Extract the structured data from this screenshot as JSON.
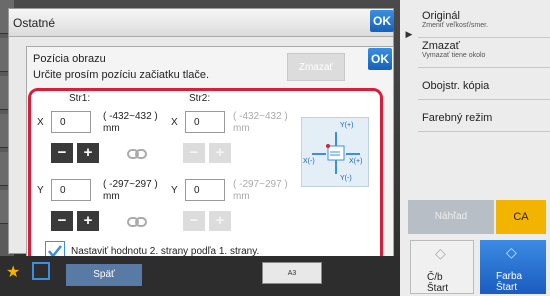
{
  "outer_dialog": {
    "title": "Ostatné",
    "ok_label": "OK"
  },
  "inner_dialog": {
    "title": "Pozícia obrazu",
    "subtitle": "Určite prosím pozíciu začiatku tlače.",
    "clear_label": "Zmazať",
    "ok_label": "OK"
  },
  "side1": {
    "header": "Str1:",
    "x_axis": "X",
    "x_value": "0",
    "x_range": "( -432~432 )",
    "x_unit": "mm",
    "y_axis": "Y",
    "y_value": "0",
    "y_range": "( -297~297 )",
    "y_unit": "mm",
    "minus": "−",
    "plus": "+"
  },
  "side2": {
    "header": "Str2:",
    "x_axis": "X",
    "x_value": "0",
    "x_range": "( -432~432 )",
    "x_unit": "mm",
    "y_axis": "Y",
    "y_value": "0",
    "y_range": "( -297~297 )",
    "y_unit": "mm",
    "minus": "−",
    "plus": "+"
  },
  "diagram": {
    "y_plus": "Y(+)",
    "y_minus": "Y(-)",
    "x_plus": "X(+)",
    "x_minus": "X(-)"
  },
  "same_as_side1_label": "Nastaviť hodnotu 2. strany podľa 1. strany.",
  "sidebar": {
    "items": [
      {
        "label": "Originál",
        "sub": "Zmeniť veľkosť/smer."
      },
      {
        "label": "Zmazať",
        "sub": "Vymazať tiene okolo"
      },
      {
        "label": "Obojstr. kópia",
        "sub": ""
      },
      {
        "label": "Farebný režim",
        "sub": ""
      }
    ]
  },
  "bottom": {
    "back_label": "Späť",
    "paper_label": "A3"
  },
  "actions": {
    "gray_label": "Náhľad",
    "ca_label": "CA",
    "start_bw": [
      "Č/b",
      "Štart"
    ],
    "start_color": [
      "Farba",
      "Štart"
    ]
  },
  "colors": {
    "accent": "#1562b8",
    "frame": "#d71f3b",
    "ca": "#f2b400"
  }
}
